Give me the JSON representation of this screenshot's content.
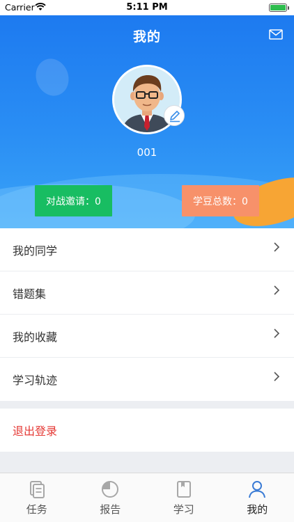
{
  "status_bar": {
    "carrier": "Carrier",
    "time": "5:11 PM"
  },
  "header": {
    "title": "我的",
    "user_id": "001"
  },
  "stats": {
    "battle_invites": "对战邀请：0",
    "bean_total": "学豆总数：0"
  },
  "menu": [
    {
      "label": "我的同学"
    },
    {
      "label": "错题集"
    },
    {
      "label": "我的收藏"
    },
    {
      "label": "学习轨迹"
    }
  ],
  "logout_label": "退出登录",
  "tabs": [
    {
      "label": "任务",
      "icon": "task-icon",
      "active": false
    },
    {
      "label": "报告",
      "icon": "report-icon",
      "active": false
    },
    {
      "label": "学习",
      "icon": "study-icon",
      "active": false
    },
    {
      "label": "我的",
      "icon": "profile-icon",
      "active": true
    }
  ],
  "colors": {
    "header_blue": "#1d7af0",
    "battle_green": "#18bd62",
    "beans_orange": "#f7916a",
    "logout_red": "#e53935",
    "active_tab": "#3a7bd5",
    "inactive_tab": "#a7a7a7"
  }
}
